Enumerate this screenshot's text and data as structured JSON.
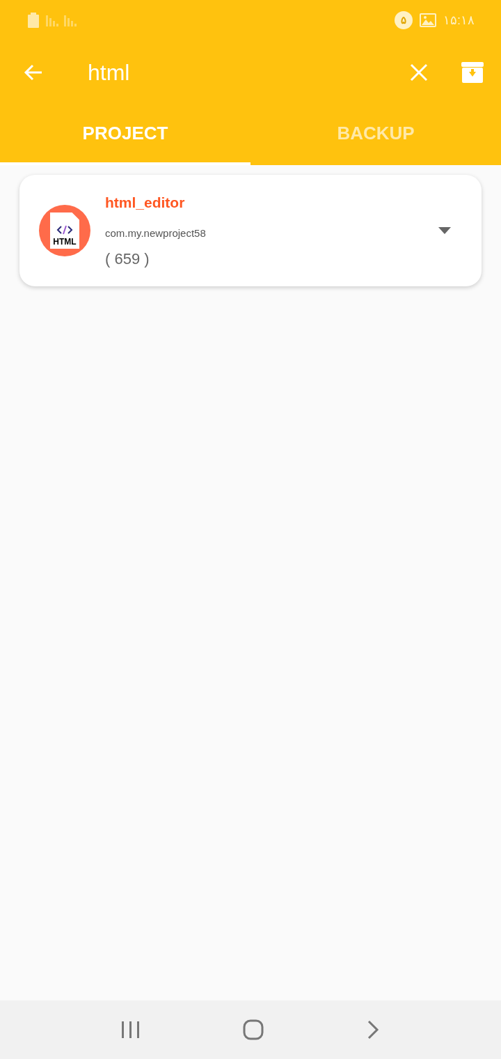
{
  "status_bar": {
    "notification_count": "۵",
    "time": "۱۵:۱۸"
  },
  "search": {
    "value": "html"
  },
  "tabs": [
    {
      "label": "PROJECT",
      "selected": true
    },
    {
      "label": "BACKUP",
      "selected": false
    }
  ],
  "projects": [
    {
      "name": "html_editor",
      "package": "com.my.newproject58",
      "count": "( 659 )",
      "icon_label": "HTML"
    }
  ]
}
